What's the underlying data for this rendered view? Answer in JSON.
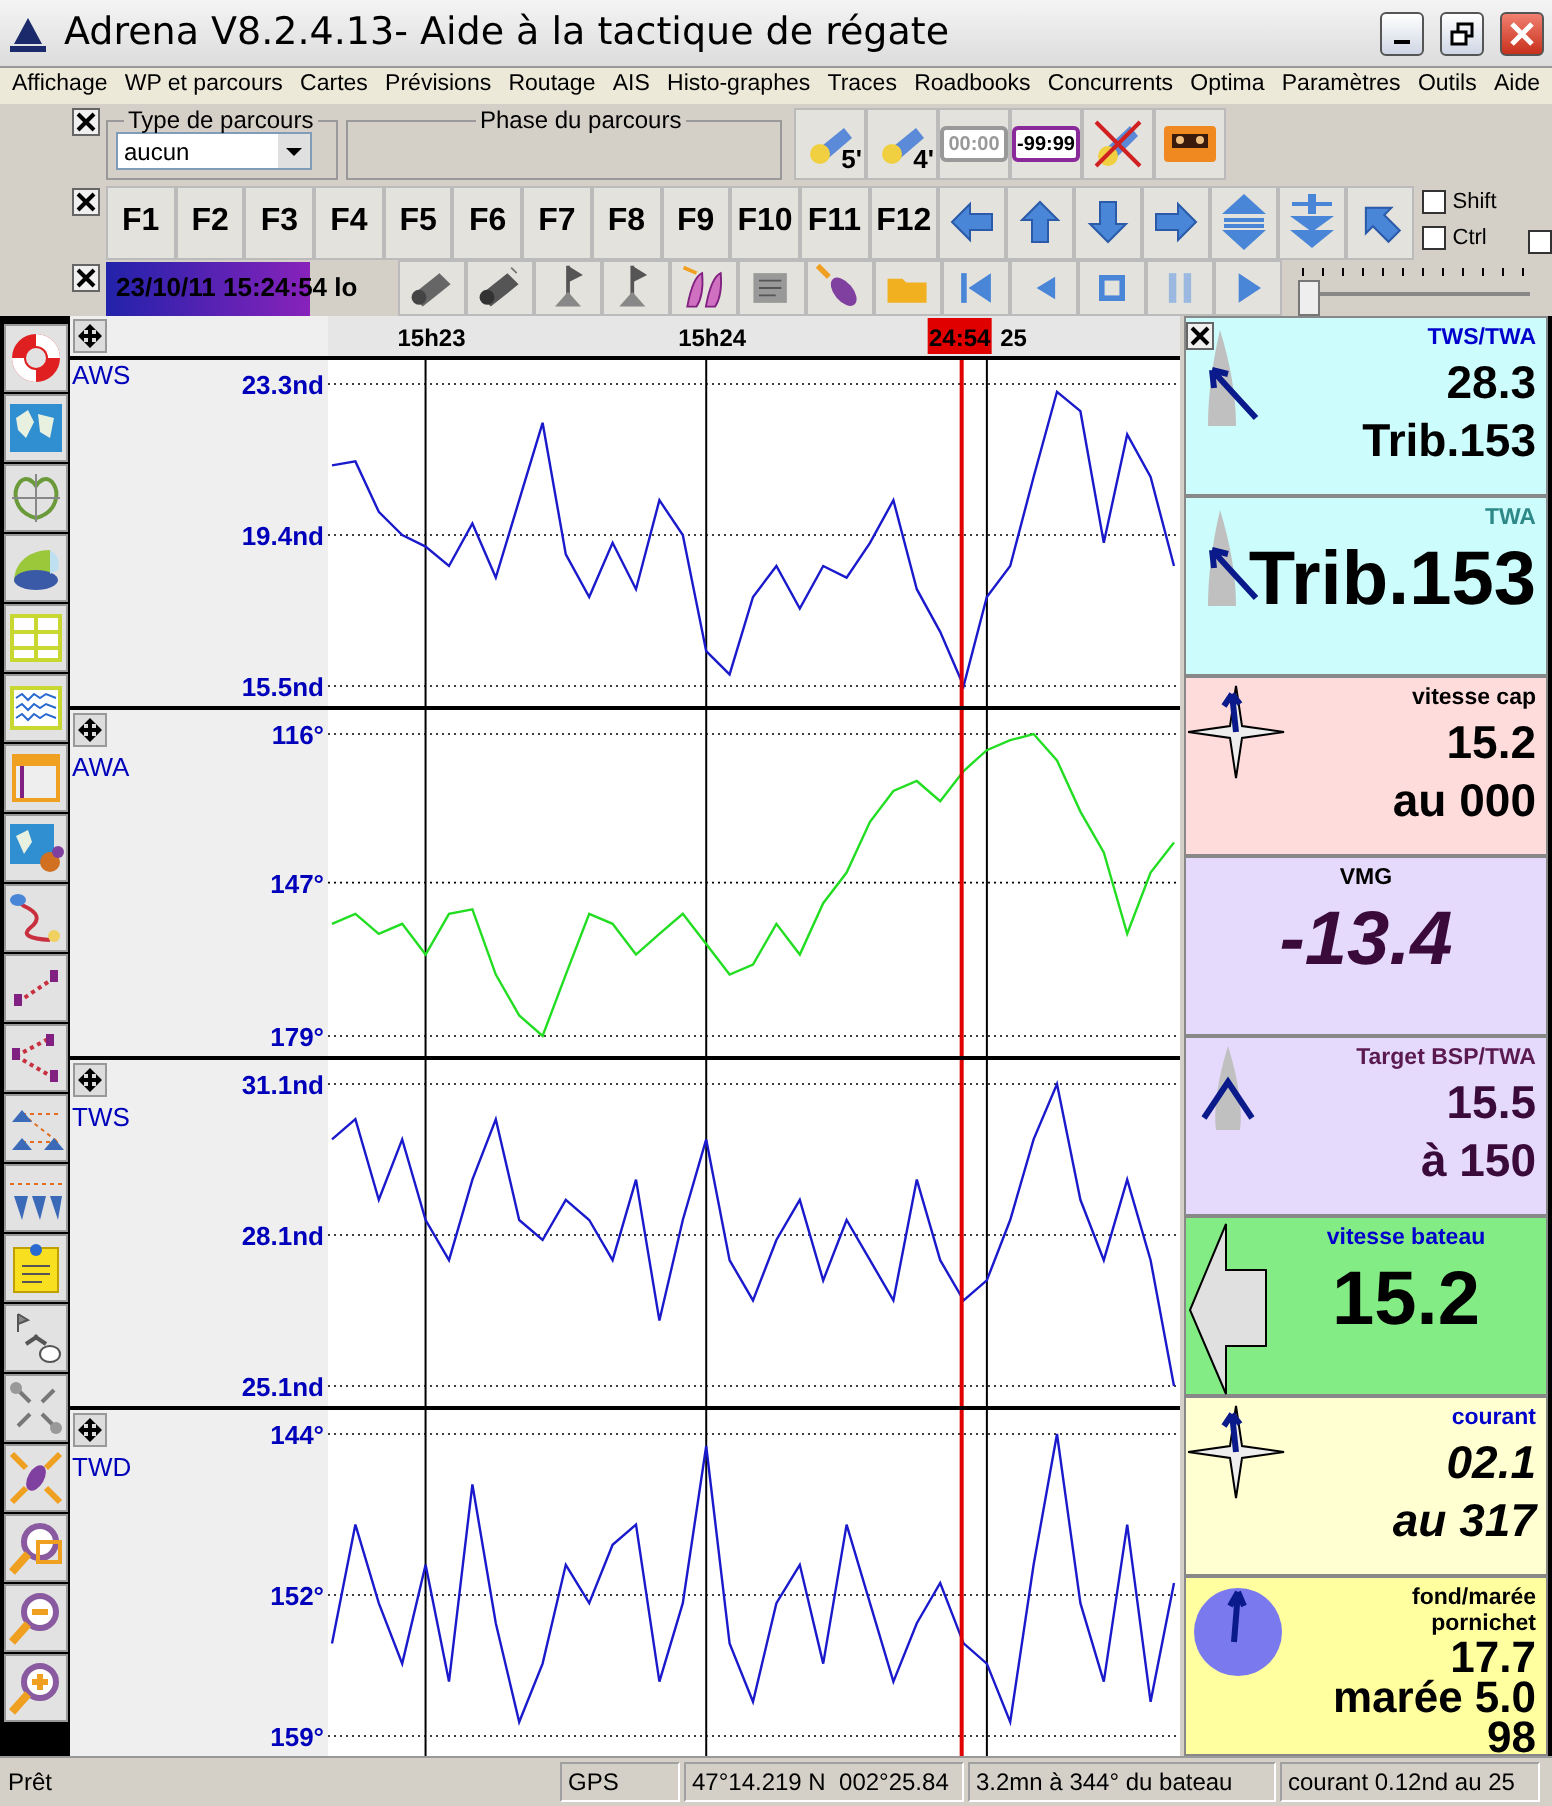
{
  "window": {
    "title": "Adrena V8.2.4.13- Aide à la tactique de régate"
  },
  "menu": [
    "Affichage",
    "WP et parcours",
    "Cartes",
    "Prévisions",
    "Routage",
    "AIS",
    "Histo-graphes",
    "Traces",
    "Roadbooks",
    "Concurrents",
    "Optima",
    "Paramètres",
    "Outils",
    "Aide"
  ],
  "course_bar": {
    "course_type": {
      "legend": "Type de parcours",
      "value": "aucun"
    },
    "course_phase": {
      "legend": "Phase du parcours"
    },
    "buttons": [
      {
        "kind": "timer",
        "label": "5'"
      },
      {
        "kind": "timer",
        "label": "4'"
      },
      {
        "kind": "display",
        "label": "00:00",
        "disabled": true
      },
      {
        "kind": "display",
        "label": "-99:99",
        "disabled": false
      },
      {
        "kind": "cancel"
      },
      {
        "kind": "cassette"
      }
    ]
  },
  "function_keys": [
    "F1",
    "F2",
    "F3",
    "F4",
    "F5",
    "F6",
    "F7",
    "F8",
    "F9",
    "F10",
    "F11",
    "F12"
  ],
  "modifier_checkboxes": [
    {
      "label": "Shift",
      "checked": false
    },
    {
      "label": "Ctrl",
      "checked": false
    },
    {
      "checked": false
    }
  ],
  "playback": {
    "datetime": "23/10/11 15:24:54 lo",
    "slider": {
      "level": 0.04
    }
  },
  "time_cursor": {
    "label": "24:54",
    "level": 0.742
  },
  "charts": [
    {
      "chart_data": {
        "type": "line",
        "grid": true,
        "ref_lines": [
          {
            "axis": "y",
            "value": 19.4
          }
        ],
        "ylim": [
          15.5,
          23.3
        ],
        "yticks": [
          {
            "value": 23.3,
            "label": "23.3nd"
          },
          {
            "value": 19.4,
            "label": "19.4nd"
          },
          {
            "value": 15.5,
            "label": "15.5nd"
          }
        ],
        "categories": [
          null,
          null,
          null,
          null,
          "15h23",
          null,
          null,
          null,
          null,
          null,
          null,
          null,
          null,
          null,
          null,
          null,
          "15h24",
          null,
          null,
          null,
          null,
          null,
          null,
          null,
          null,
          null,
          null,
          null,
          "25",
          null,
          null,
          null,
          null,
          null,
          null,
          null,
          null
        ],
        "series": [
          {
            "name": "AWS",
            "color": "#1a1acc",
            "values": [
              21.2,
              21.3,
              20.0,
              19.4,
              19.1,
              18.6,
              19.7,
              18.3,
              20.3,
              22.3,
              18.9,
              17.8,
              19.2,
              18.0,
              20.3,
              19.4,
              16.4,
              15.8,
              17.8,
              18.6,
              17.5,
              18.6,
              18.3,
              19.2,
              20.3,
              18.0,
              16.9,
              15.5,
              17.8,
              18.6,
              20.9,
              23.1,
              22.6,
              19.2,
              22.0,
              20.9,
              18.6
            ]
          }
        ]
      }
    },
    {
      "chart_data": {
        "type": "line",
        "grid": true,
        "ref_lines": [
          {
            "axis": "y",
            "value": 147
          }
        ],
        "ylim": [
          179,
          116
        ],
        "yticks": [
          {
            "value": 116,
            "label": "116°"
          },
          {
            "value": 147,
            "label": "147°"
          },
          {
            "value": 179,
            "label": "179°"
          }
        ],
        "categories": [
          null,
          null,
          null,
          null,
          null,
          null,
          null,
          null,
          null,
          null,
          null,
          null,
          null,
          null,
          null,
          null,
          null,
          null,
          null,
          null,
          null,
          null,
          null,
          null,
          null,
          null,
          null,
          null,
          null,
          null,
          null,
          null,
          null,
          null,
          null,
          null,
          null
        ],
        "series": [
          {
            "name": "AWA",
            "color": "#22dd22",
            "values": [
              155.6,
              153.5,
              157.7,
              155.6,
              162.0,
              153.5,
              152.6,
              166.2,
              174.7,
              179,
              166.2,
              153.5,
              155.6,
              162.0,
              157.7,
              153.5,
              159.8,
              166.2,
              164.1,
              155.6,
              162.0,
              151.3,
              144.9,
              134.3,
              127.9,
              125.8,
              130.0,
              123.7,
              119.4,
              117.3,
              116,
              121.5,
              132.2,
              140.7,
              157.7,
              144.9,
              138.6
            ]
          }
        ]
      }
    },
    {
      "chart_data": {
        "type": "line",
        "grid": true,
        "ref_lines": [
          {
            "axis": "y",
            "value": 28.1
          }
        ],
        "ylim": [
          25.1,
          31.1
        ],
        "yticks": [
          {
            "value": 31.1,
            "label": "31.1nd"
          },
          {
            "value": 28.1,
            "label": "28.1nd"
          },
          {
            "value": 25.1,
            "label": "25.1nd"
          }
        ],
        "categories": [
          null,
          null,
          null,
          null,
          null,
          null,
          null,
          null,
          null,
          null,
          null,
          null,
          null,
          null,
          null,
          null,
          null,
          null,
          null,
          null,
          null,
          null,
          null,
          null,
          null,
          null,
          null,
          null,
          null,
          null,
          null,
          null,
          null,
          null,
          null,
          null,
          null
        ],
        "series": [
          {
            "name": "TWS",
            "color": "#1a1acc",
            "values": [
              30.0,
              30.4,
              28.8,
              30.0,
              28.4,
              27.6,
              29.2,
              30.4,
              28.4,
              28.0,
              28.8,
              28.4,
              27.6,
              29.2,
              26.4,
              28.4,
              30.0,
              27.6,
              26.8,
              28.0,
              28.8,
              27.2,
              28.4,
              27.6,
              26.8,
              29.2,
              27.6,
              26.8,
              27.2,
              28.4,
              30.0,
              31.1,
              28.8,
              27.6,
              29.2,
              27.6,
              25.1
            ]
          }
        ]
      }
    },
    {
      "chart_data": {
        "type": "line",
        "grid": true,
        "ref_lines": [
          {
            "axis": "y",
            "value": 152
          }
        ],
        "ylim": [
          159,
          144
        ],
        "yticks": [
          {
            "value": 144,
            "label": "144°"
          },
          {
            "value": 152,
            "label": "152°"
          },
          {
            "value": 159,
            "label": "159°"
          }
        ],
        "categories": [
          null,
          null,
          null,
          null,
          null,
          null,
          null,
          null,
          null,
          null,
          null,
          null,
          null,
          null,
          null,
          null,
          null,
          null,
          null,
          null,
          null,
          null,
          null,
          null,
          null,
          null,
          null,
          null,
          null,
          null,
          null,
          null,
          null,
          null,
          null,
          null,
          null
        ],
        "series": [
          {
            "name": "TWD",
            "color": "#1a1acc",
            "values": [
              154.4,
              148.5,
              152.4,
              155.4,
              150.5,
              156.3,
              146.5,
              153.4,
              158.3,
              155.4,
              150.5,
              152.4,
              149.5,
              148.5,
              156.3,
              152.4,
              144.6,
              154.4,
              157.3,
              152.4,
              150.5,
              155.4,
              148.5,
              152.4,
              156.3,
              153.4,
              151.4,
              154.4,
              155.4,
              158.3,
              150.5,
              144,
              152.4,
              156.3,
              148.5,
              157.3,
              151.4
            ]
          }
        ]
      }
    }
  ],
  "instruments": [
    {
      "kind": "boat",
      "title": "TWS/TWA",
      "values": [
        "28.3",
        "Trib.153"
      ],
      "italic": false,
      "color": "#ccfcfc"
    },
    {
      "kind": "boat",
      "title": "TWA",
      "values": [
        "Trib.153"
      ],
      "italic": false,
      "color": "#ccfcfc"
    },
    {
      "kind": "compass",
      "title": "vitesse cap",
      "values": [
        "15.2",
        "au 000"
      ],
      "italic": false,
      "color": "#ffdcdc"
    },
    {
      "kind": "plain",
      "title": "VMG",
      "values": [
        "-13.4"
      ],
      "italic": true,
      "color": "#e6dafc"
    },
    {
      "kind": "boat-target",
      "title": "Target BSP/TWA",
      "values": [
        "15.5",
        "à 150"
      ],
      "italic": false,
      "color": "#e6dafc"
    },
    {
      "kind": "speed-arrow",
      "title": "vitesse bateau",
      "values": [
        "15.2"
      ],
      "italic": false,
      "color": "#84ec84"
    },
    {
      "kind": "compass",
      "title": "courant",
      "values": [
        "02.1",
        "au 317"
      ],
      "italic": true,
      "color": "#ffffd2"
    },
    {
      "kind": "disc",
      "title": "fond/marée",
      "subtitle": "pornichet",
      "values": [
        "17.7",
        "marée 5.0",
        "98"
      ],
      "italic": false,
      "color": "#ffffa0"
    }
  ],
  "status_bar": [
    "Prêt",
    "GPS",
    "47°14.219 N  002°25.84",
    "3.2mn à 344° du bateau",
    "courant 0.12nd au 25"
  ]
}
